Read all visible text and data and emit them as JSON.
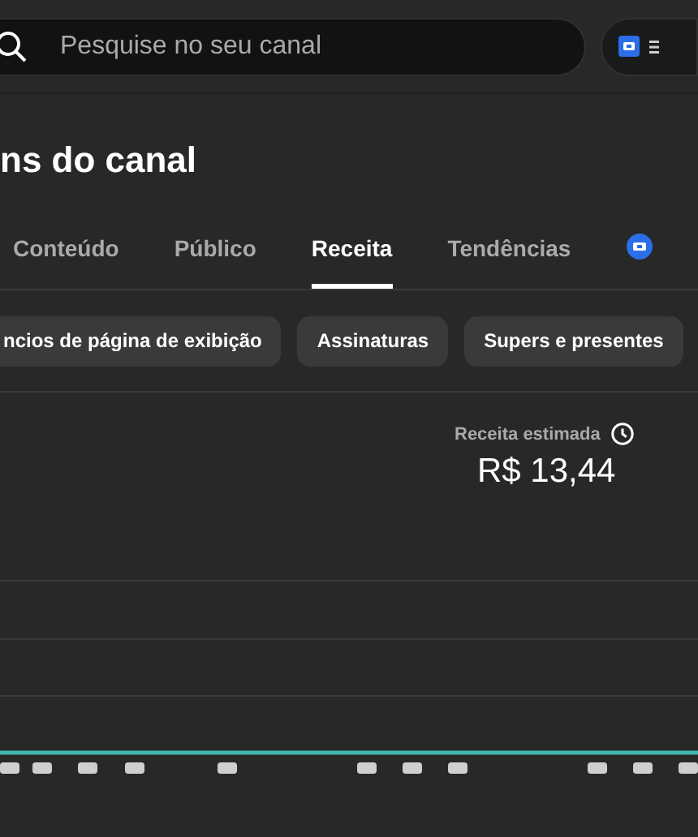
{
  "search": {
    "placeholder": "Pesquise no seu canal"
  },
  "page_title": "ns do canal",
  "tabs": [
    {
      "label": "Conteúdo",
      "selected": false
    },
    {
      "label": "Público",
      "selected": false
    },
    {
      "label": "Receita",
      "selected": true
    },
    {
      "label": "Tendências",
      "selected": false
    }
  ],
  "chips": [
    "ncios de página de exibição",
    "Assinaturas",
    "Supers e presentes"
  ],
  "metric": {
    "label": "Receita estimada",
    "value": "R$ 13,44"
  }
}
